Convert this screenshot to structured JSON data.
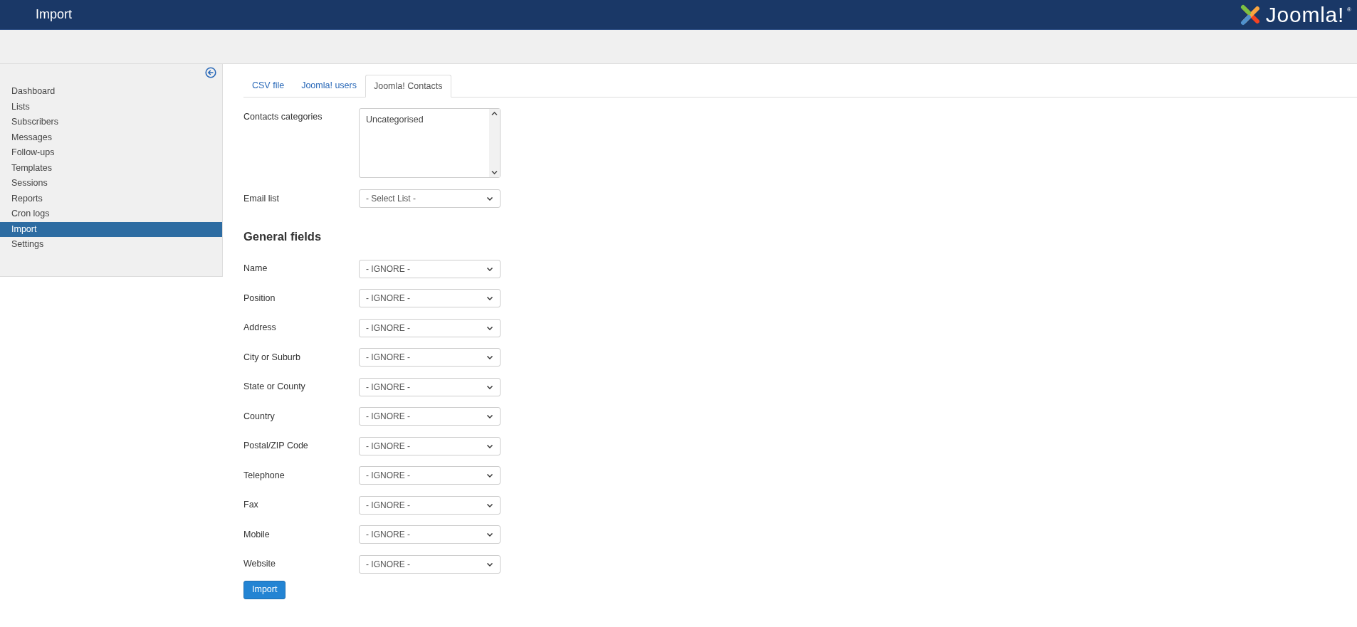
{
  "header": {
    "title": "Import",
    "logo_text": "Joomla!",
    "logo_mark": "®"
  },
  "sidebar": {
    "items": [
      {
        "label": "Dashboard",
        "selected": false
      },
      {
        "label": "Lists",
        "selected": false
      },
      {
        "label": "Subscribers",
        "selected": false
      },
      {
        "label": "Messages",
        "selected": false
      },
      {
        "label": "Follow-ups",
        "selected": false
      },
      {
        "label": "Templates",
        "selected": false
      },
      {
        "label": "Sessions",
        "selected": false
      },
      {
        "label": "Reports",
        "selected": false
      },
      {
        "label": "Cron logs",
        "selected": false
      },
      {
        "label": "Import",
        "selected": true
      },
      {
        "label": "Settings",
        "selected": false
      }
    ]
  },
  "tabs": [
    {
      "label": "CSV file",
      "selected": false
    },
    {
      "label": "Joomla! users",
      "selected": false
    },
    {
      "label": "Joomla! Contacts",
      "selected": true
    }
  ],
  "contacts_categories": {
    "label": "Contacts categories",
    "options": [
      "Uncategorised"
    ]
  },
  "email_list": {
    "label": "Email list",
    "value": "- Select List -"
  },
  "general_fields": {
    "heading": "General fields",
    "fields": [
      {
        "label": "Name",
        "value": "- IGNORE -"
      },
      {
        "label": "Position",
        "value": "- IGNORE -"
      },
      {
        "label": "Address",
        "value": "- IGNORE -"
      },
      {
        "label": "City or Suburb",
        "value": "- IGNORE -"
      },
      {
        "label": "State or County",
        "value": "- IGNORE -"
      },
      {
        "label": "Country",
        "value": "- IGNORE -"
      },
      {
        "label": "Postal/ZIP Code",
        "value": "- IGNORE -"
      },
      {
        "label": "Telephone",
        "value": "- IGNORE -"
      },
      {
        "label": "Fax",
        "value": "- IGNORE -"
      },
      {
        "label": "Mobile",
        "value": "- IGNORE -"
      },
      {
        "label": "Website",
        "value": "- IGNORE -"
      }
    ]
  },
  "submit": {
    "label": "Import"
  }
}
